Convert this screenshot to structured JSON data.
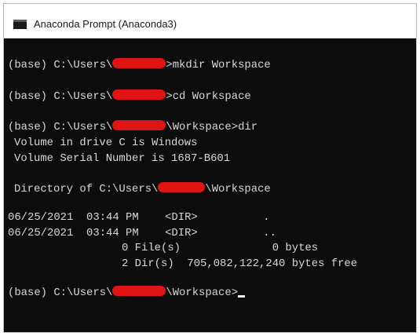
{
  "window": {
    "title": "Anaconda Prompt (Anaconda3)",
    "icon": "console-window-icon"
  },
  "console": {
    "prompt_prefix": "(base) C:\\Users\\",
    "dir_prefix": "Directory of C:\\Users\\",
    "line1_suffix": ">mkdir Workspace",
    "line2_suffix": ">cd Workspace",
    "line3_suffix": "\\Workspace>dir",
    "volume_label": "Volume in drive C is Windows",
    "volume_serial": "Volume Serial Number is 1687-B601",
    "dir_suffix": "\\Workspace",
    "entries": [
      {
        "date": "06/25/2021",
        "time": "03:44 PM",
        "type": "<DIR>",
        "name": "."
      },
      {
        "date": "06/25/2021",
        "time": "03:44 PM",
        "type": "<DIR>",
        "name": ".."
      }
    ],
    "files_summary": "0 File(s)              0 bytes",
    "dirs_summary": "2 Dir(s)  705,082,122,240 bytes free",
    "final_suffix": "\\Workspace>",
    "redaction_color": "#e01414",
    "background_color": "#0c0c0c",
    "text_color": "#d8d8d8"
  }
}
